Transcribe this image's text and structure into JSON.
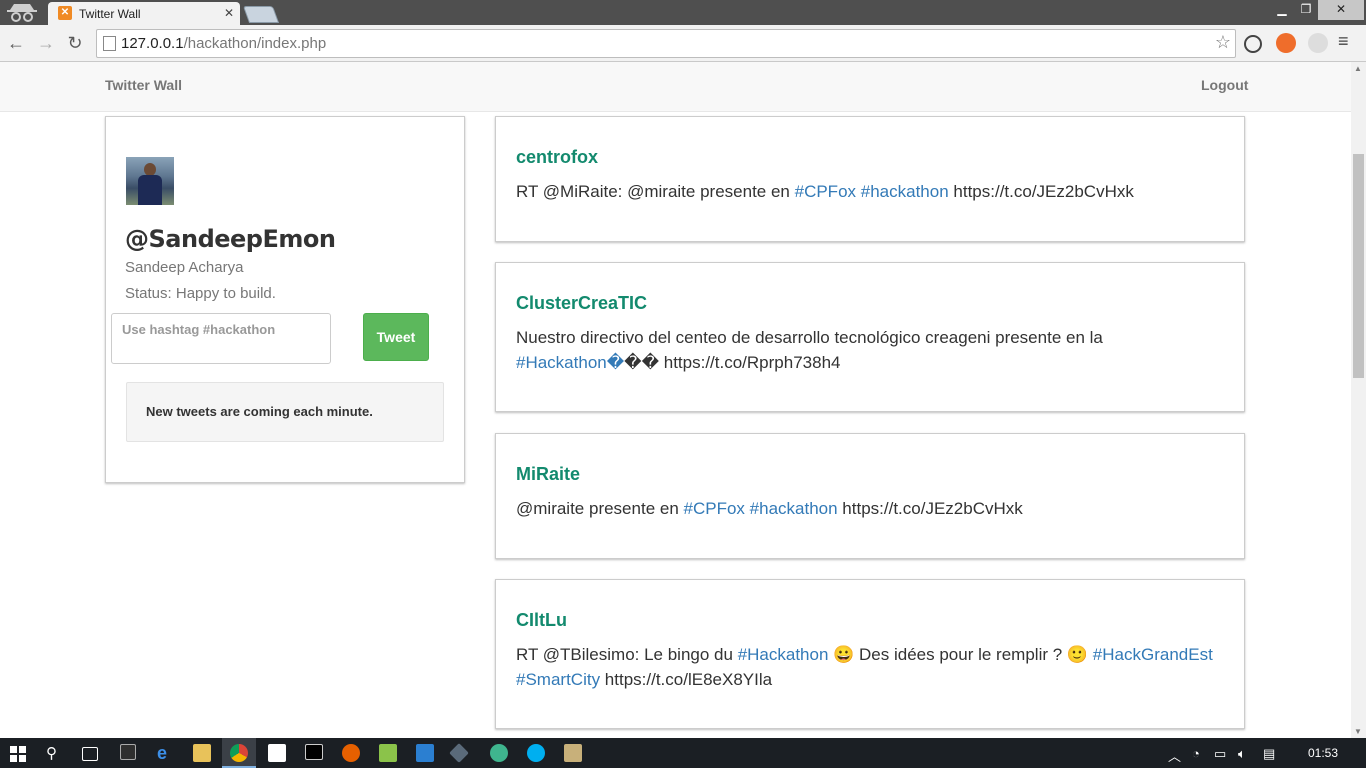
{
  "browser": {
    "tab_title": "Twitter Wall",
    "url_host": "127.0.0.1",
    "url_path": "/hackathon/index.php"
  },
  "navbar": {
    "brand": "Twitter Wall",
    "logout": "Logout"
  },
  "profile": {
    "handle": "@SandeepEmon",
    "name": "Sandeep Acharya",
    "status_label": "Status:",
    "status_value": "Happy to build.",
    "tweet_placeholder": "Use hashtag #hackathon",
    "tweet_button": "Tweet",
    "info": "New tweets are coming each minute."
  },
  "tweets": [
    {
      "user": "centrofox",
      "t1": "RT @MiRaite: @miraite presente en ",
      "h1": "#CPFox",
      "t2": " ",
      "h2": "#hackathon",
      "t3": " https://t.co/JEz2bCvHxk"
    },
    {
      "user": "ClusterCreaTIC",
      "t1": "Nuestro directivo del centeo de desarrollo tecnológico creageni presente en la ",
      "h1": "#Hackathon",
      "t2": "�",
      "t3": "�� https://t.co/Rprph738h4"
    },
    {
      "user": "MiRaite",
      "t1": "@miraite presente en ",
      "h1": "#CPFox",
      "t2": " ",
      "h2": "#hackathon",
      "t3": " https://t.co/JEz2bCvHxk"
    },
    {
      "user": "CIltLu",
      "t1": "RT @TBilesimo: Le bingo du ",
      "h1": "#Hackathon",
      "t2": " 😀 Des idées pour le remplir ? 🙂 ",
      "h2": "#HackGrandEst",
      "t3": " ",
      "h3": "#SmartCity",
      "t4": " https://t.co/lE8eX8YIla"
    }
  ],
  "taskbar": {
    "clock": "01:53"
  },
  "colors": {
    "username": "#138a6e",
    "hashtag": "#337ab7",
    "tweet_button": "#5cb85c"
  }
}
